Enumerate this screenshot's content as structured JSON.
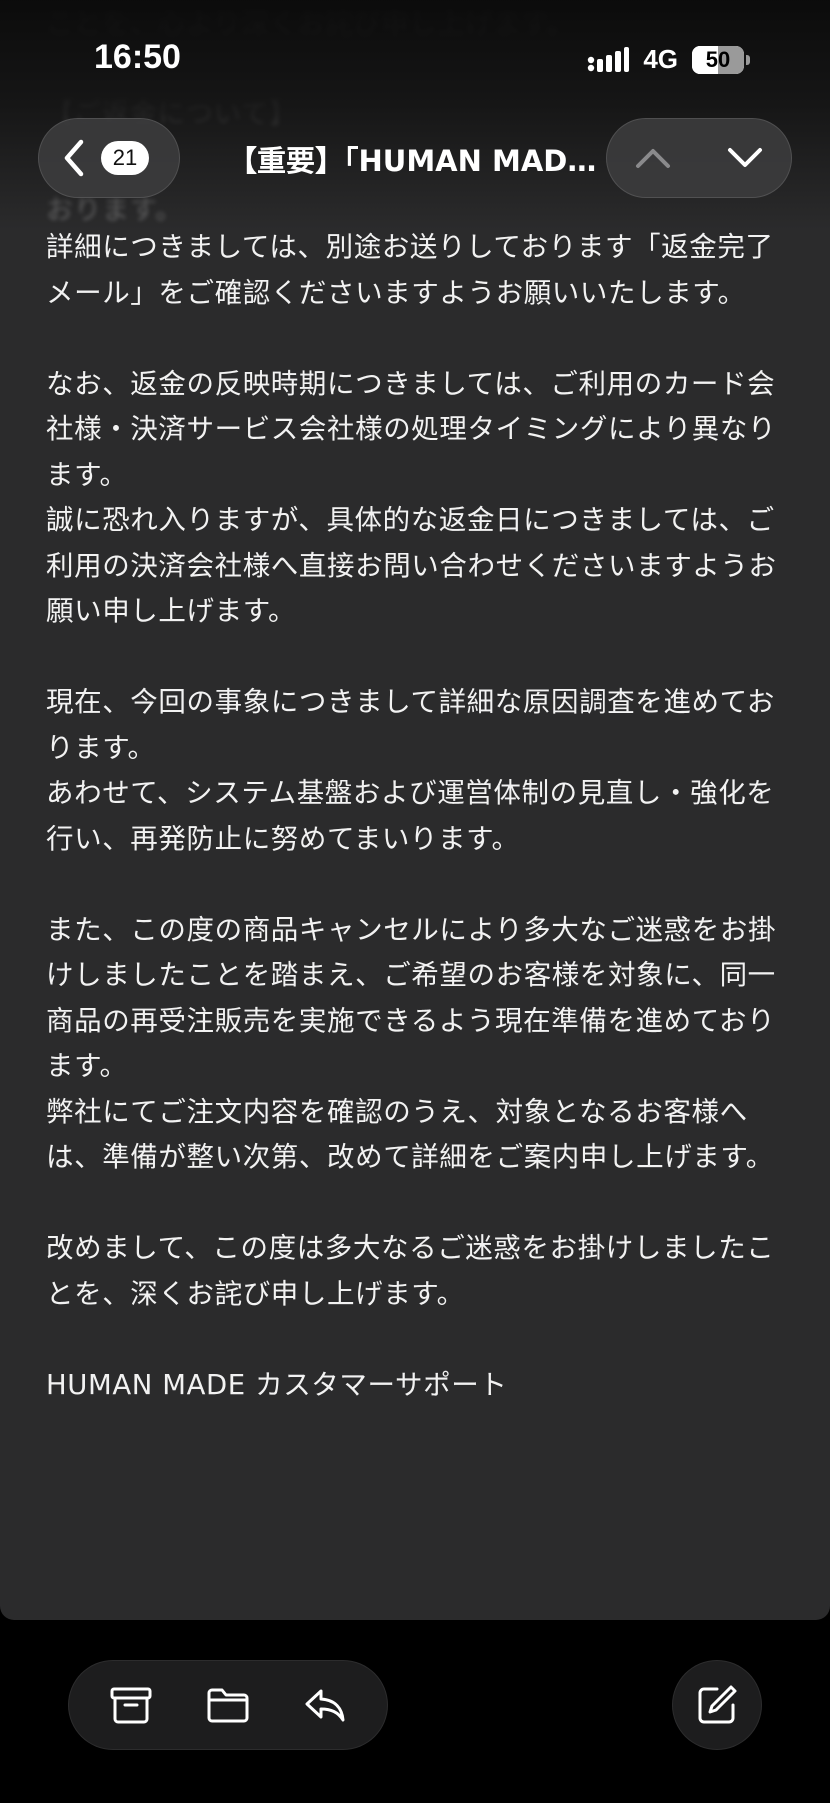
{
  "status_bar": {
    "time": "16:50",
    "network": "4G",
    "battery_level": "50",
    "battery_fraction": 0.5
  },
  "header": {
    "back_count": "21",
    "title": "【重要】「HUMAN MADE…"
  },
  "faded_lines": [
    "ことを、心より深くお詫び申し上げます。",
    "【ご返金について】",
    "おります。"
  ],
  "body": {
    "paragraphs": [
      "詳細につきましては、別途お送りしております「返金完了メール」をご確認くださいますようお願いいたします。",
      "",
      "なお、返金の反映時期につきましては、ご利用のカード会社様・決済サービス会社様の処理タイミングにより異なります。",
      "誠に恐れ入りますが、具体的な返金日につきましては、ご利用の決済会社様へ直接お問い合わせくださいますようお願い申し上げます。",
      "",
      "現在、今回の事象につきまして詳細な原因調査を進めております。",
      "あわせて、システム基盤および運営体制の見直し・強化を行い、再発防止に努めてまいります。",
      "",
      "また、この度の商品キャンセルにより多大なご迷惑をお掛けしましたことを踏まえ、ご希望のお客様を対象に、同一商品の再受注販売を実施できるよう現在準備を進めております。",
      "弊社にてご注文内容を確認のうえ、対象となるお客様へは、準備が整い次第、改めて詳細をご案内申し上げます。",
      "",
      "改めまして、この度は多大なるご迷惑をお掛けしましたことを、深くお詫び申し上げます。",
      "",
      "HUMAN MADE カスタマーサポート"
    ]
  },
  "icons": {
    "back": "chevron-left-icon",
    "prev": "chevron-up-icon",
    "next": "chevron-down-icon",
    "archive": "archive-box-icon",
    "move": "folder-icon",
    "reply": "reply-arrow-icon",
    "compose": "compose-icon"
  },
  "colors": {
    "background": "#000000",
    "card": "#2b2b2c",
    "text": "#f2f2f2",
    "pill": "#3c3c3e",
    "toolbar": "#1d1d1e"
  }
}
